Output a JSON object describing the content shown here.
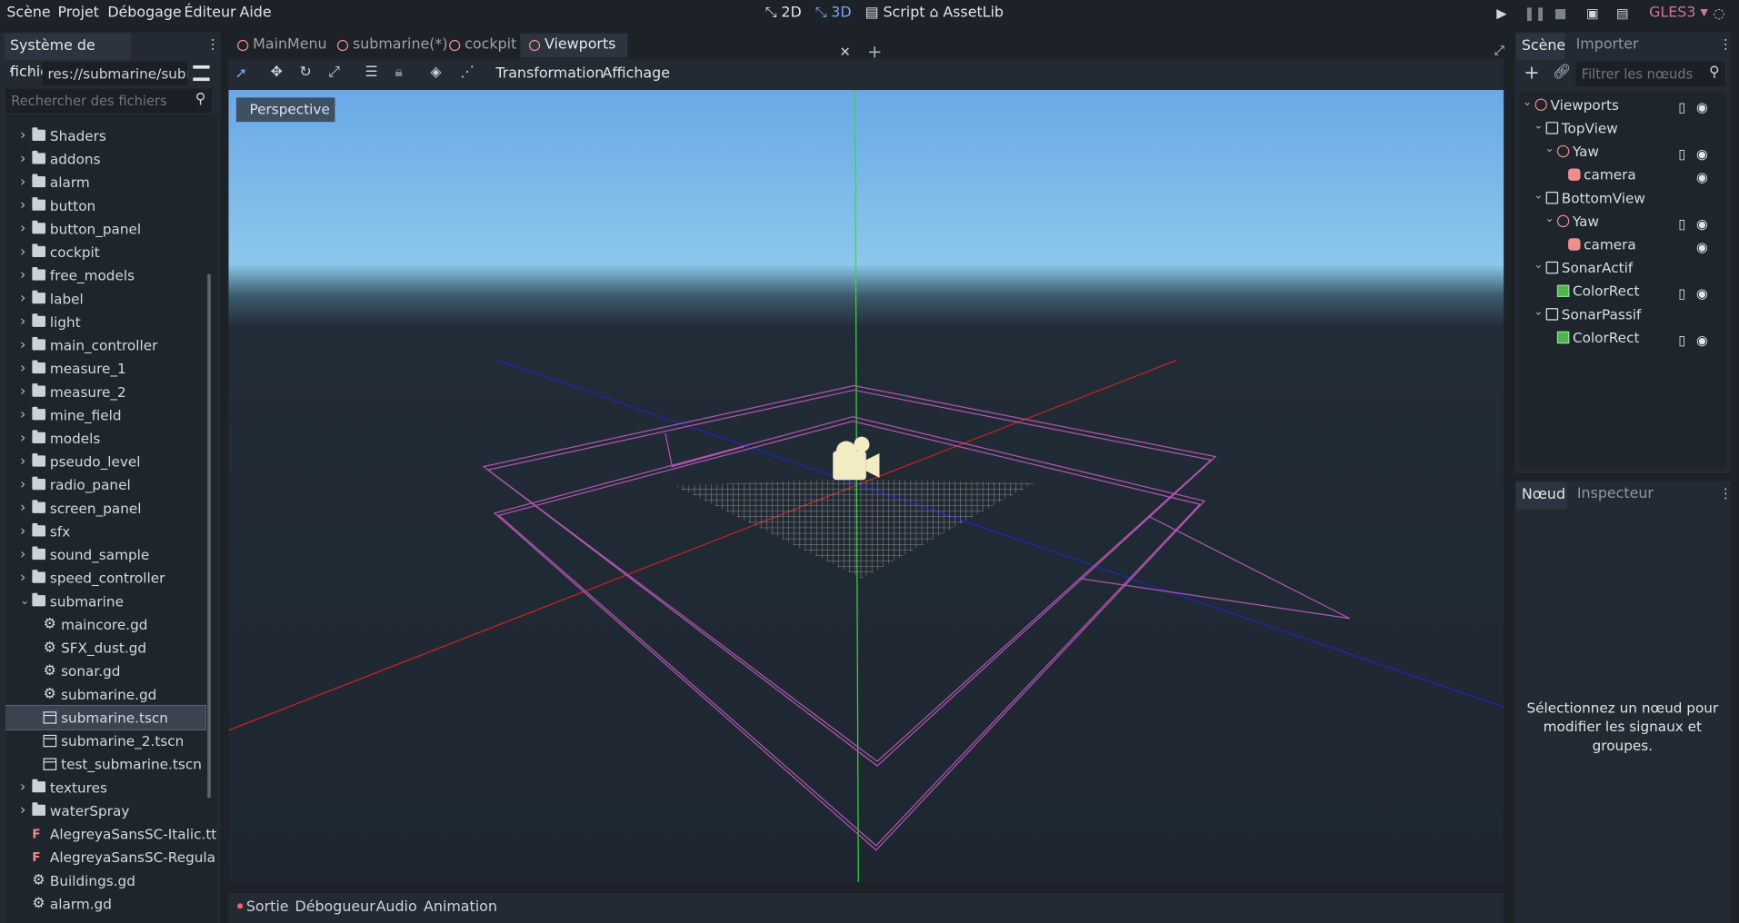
{
  "menubar": {
    "scene": "Scène",
    "project": "Projet",
    "debug": "Débogage",
    "editor": "Éditeur",
    "help": "Aide",
    "mode_2d": "2D",
    "mode_3d": "3D",
    "script": "Script",
    "assetlib": "AssetLib",
    "renderer": "GLES3"
  },
  "filesystem": {
    "tab": "Système de fichiers",
    "path": "res://submarine/subma",
    "search_placeholder": "Rechercher des fichiers",
    "items": [
      {
        "label": "Shaders",
        "type": "folder"
      },
      {
        "label": "addons",
        "type": "folder"
      },
      {
        "label": "alarm",
        "type": "folder"
      },
      {
        "label": "button",
        "type": "folder"
      },
      {
        "label": "button_panel",
        "type": "folder"
      },
      {
        "label": "cockpit",
        "type": "folder"
      },
      {
        "label": "free_models",
        "type": "folder"
      },
      {
        "label": "label",
        "type": "folder"
      },
      {
        "label": "light",
        "type": "folder"
      },
      {
        "label": "main_controller",
        "type": "folder"
      },
      {
        "label": "measure_1",
        "type": "folder"
      },
      {
        "label": "measure_2",
        "type": "folder"
      },
      {
        "label": "mine_field",
        "type": "folder"
      },
      {
        "label": "models",
        "type": "folder"
      },
      {
        "label": "pseudo_level",
        "type": "folder"
      },
      {
        "label": "radio_panel",
        "type": "folder"
      },
      {
        "label": "screen_panel",
        "type": "folder"
      },
      {
        "label": "sfx",
        "type": "folder"
      },
      {
        "label": "sound_sample",
        "type": "folder"
      },
      {
        "label": "speed_controller",
        "type": "folder"
      },
      {
        "label": "submarine",
        "type": "folder-open"
      },
      {
        "label": "maincore.gd",
        "type": "script",
        "indent": 1
      },
      {
        "label": "SFX_dust.gd",
        "type": "script",
        "indent": 1
      },
      {
        "label": "sonar.gd",
        "type": "script",
        "indent": 1
      },
      {
        "label": "submarine.gd",
        "type": "script",
        "indent": 1
      },
      {
        "label": "submarine.tscn",
        "type": "scene",
        "indent": 1,
        "selected": true
      },
      {
        "label": "submarine_2.tscn",
        "type": "scene",
        "indent": 1
      },
      {
        "label": "test_submarine.tscn",
        "type": "scene",
        "indent": 1
      },
      {
        "label": "textures",
        "type": "folder"
      },
      {
        "label": "waterSpray",
        "type": "folder"
      },
      {
        "label": "AlegreyaSansSC-Italic.ttf",
        "type": "font"
      },
      {
        "label": "AlegreyaSansSC-Regular.t",
        "type": "font"
      },
      {
        "label": "Buildings.gd",
        "type": "script"
      },
      {
        "label": "alarm.gd",
        "type": "script"
      }
    ]
  },
  "tabs": [
    {
      "label": "MainMenu"
    },
    {
      "label": "submarine(*)"
    },
    {
      "label": "cockpit"
    },
    {
      "label": "Viewports",
      "active": true
    }
  ],
  "toolbar": {
    "transform": "Transformation",
    "view": "Affichage"
  },
  "viewport": {
    "perspective": "Perspective"
  },
  "bottom": {
    "output": "Sortie",
    "debugger": "Débogueur",
    "audio": "Audio",
    "animation": "Animation"
  },
  "scene_panel": {
    "tab_scene": "Scène",
    "tab_import": "Importer",
    "filter_placeholder": "Filtrer les nœuds",
    "nodes": [
      {
        "label": "Viewports",
        "depth": 0,
        "icon": "spatial"
      },
      {
        "label": "TopView",
        "depth": 1,
        "icon": "container"
      },
      {
        "label": "Yaw",
        "depth": 2,
        "icon": "spatial"
      },
      {
        "label": "camera",
        "depth": 3,
        "icon": "camera"
      },
      {
        "label": "BottomView",
        "depth": 1,
        "icon": "container"
      },
      {
        "label": "Yaw",
        "depth": 2,
        "icon": "spatial"
      },
      {
        "label": "camera",
        "depth": 3,
        "icon": "camera"
      },
      {
        "label": "SonarActif",
        "depth": 1,
        "icon": "container"
      },
      {
        "label": "ColorRect",
        "depth": 2,
        "icon": "colorrect"
      },
      {
        "label": "SonarPassif",
        "depth": 1,
        "icon": "container"
      },
      {
        "label": "ColorRect",
        "depth": 2,
        "icon": "colorrect"
      }
    ]
  },
  "node_panel": {
    "tab_node": "Nœud",
    "tab_inspector": "Inspecteur",
    "message": "Sélectionnez un nœud pour modifier les signaux et groupes."
  },
  "colors": {
    "accent": "#76a9f2",
    "bg": "#1d2229",
    "panel": "#232a33",
    "gles": "#d3739e"
  }
}
